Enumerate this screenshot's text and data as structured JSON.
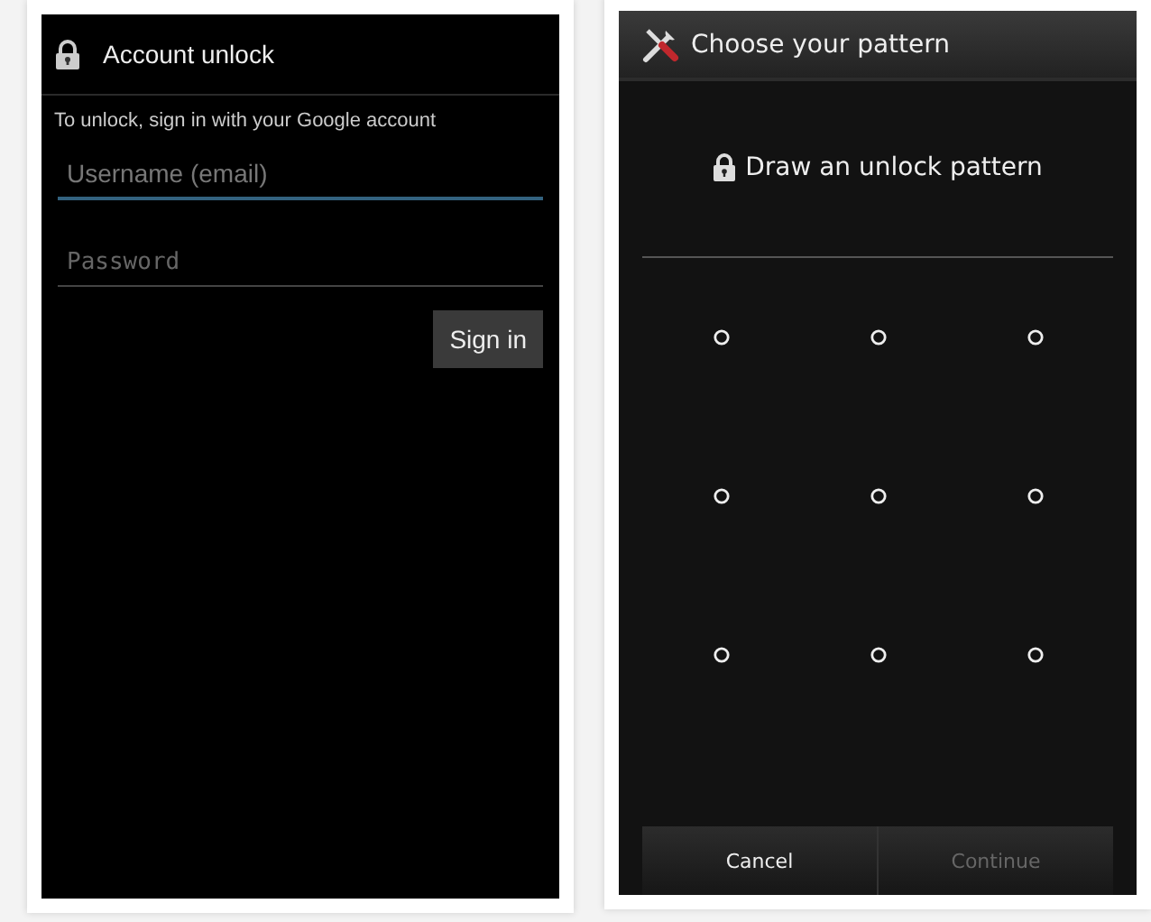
{
  "account_unlock": {
    "title": "Account unlock",
    "hint": "To unlock, sign in with your Google account",
    "fields": [
      {
        "placeholder": "Username (email)",
        "focused": true,
        "kind": "text"
      },
      {
        "placeholder": "Password",
        "focused": false,
        "kind": "password"
      }
    ],
    "button": "Sign in"
  },
  "choose_pattern": {
    "title": "Choose your pattern",
    "prompt": "Draw an unlock pattern",
    "buttons": [
      {
        "label": "Cancel",
        "disabled": false
      },
      {
        "label": "Continue",
        "disabled": true
      }
    ]
  }
}
